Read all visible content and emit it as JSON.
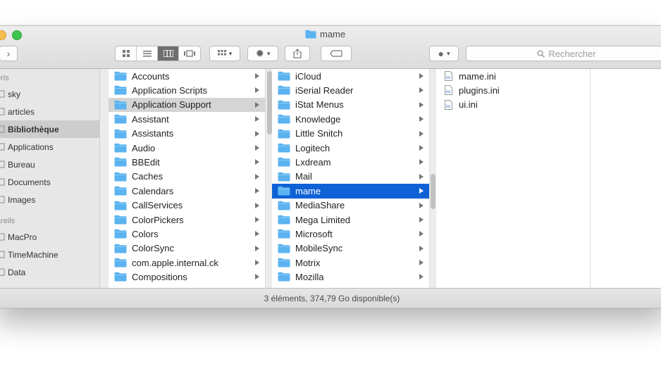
{
  "window": {
    "title": "mame"
  },
  "toolbar": {
    "search_placeholder": "Rechercher"
  },
  "sidebar": {
    "section_favorites": "oris",
    "favorites": [
      "sky",
      "articles",
      "Bibliothèque",
      "Applications",
      "Bureau",
      "Documents",
      "Images"
    ],
    "selected": "Bibliothèque",
    "section_devices": "areils",
    "devices": [
      "MacPro",
      "TimeMachine",
      "Data"
    ]
  },
  "column1": {
    "items": [
      "Accounts",
      "Application Scripts",
      "Application Support",
      "Assistant",
      "Assistants",
      "Audio",
      "BBEdit",
      "Caches",
      "Calendars",
      "CallServices",
      "ColorPickers",
      "Colors",
      "ColorSync",
      "com.apple.internal.ck",
      "Compositions"
    ],
    "selected": "Application Support"
  },
  "column2": {
    "items": [
      "iCloud",
      "iSerial Reader",
      "iStat Menus",
      "Knowledge",
      "Little Snitch",
      "Logitech",
      "Lxdream",
      "Mail",
      "mame",
      "MediaShare",
      "Mega Limited",
      "Microsoft",
      "MobileSync",
      "Motrix",
      "Mozilla"
    ],
    "selected": "mame"
  },
  "column3": {
    "files": [
      "mame.ini",
      "plugins.ini",
      "ui.ini"
    ]
  },
  "status": {
    "text": "3 éléments, 374,79 Go disponible(s)"
  },
  "colors": {
    "folder": "#5bb3f0",
    "selection": "#0f62d6",
    "inactive_selection": "#d5d5d5"
  }
}
